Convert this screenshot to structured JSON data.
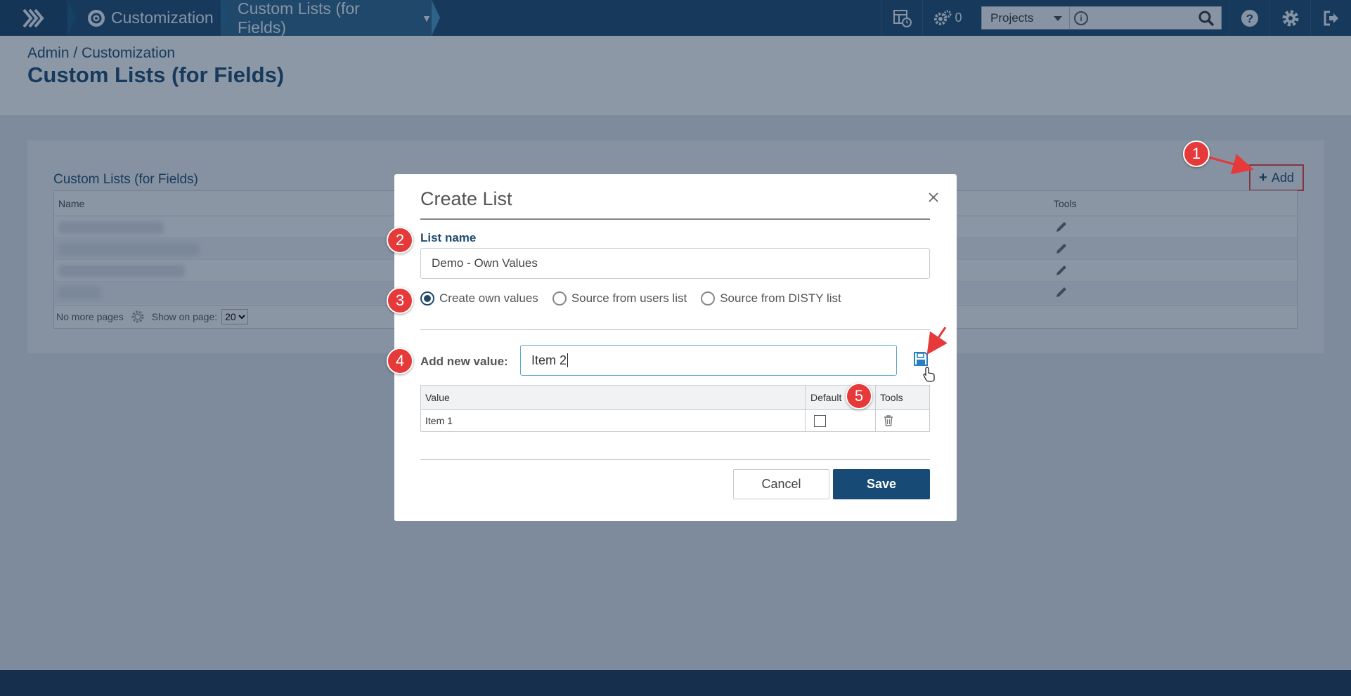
{
  "topbar": {
    "section": "Customization",
    "page": "Custom Lists (for Fields)",
    "counter": "0",
    "projects_label": "Projects",
    "search_placeholder": ""
  },
  "header": {
    "breadcrumb": "Admin / Customization",
    "title": "Custom Lists (for Fields)"
  },
  "panel": {
    "title": "Custom Lists (for Fields)",
    "add_label": "Add",
    "columns": {
      "name": "Name",
      "tools": "Tools"
    },
    "footer": {
      "pages": "No more pages",
      "show_on_page": "Show on page:",
      "page_size": "20"
    }
  },
  "modal": {
    "title": "Create List",
    "list_name_label": "List name",
    "list_name_value": "Demo - Own Values",
    "radios": [
      {
        "label": "Create own values",
        "selected": true
      },
      {
        "label": "Source from users list",
        "selected": false
      },
      {
        "label": "Source from DISTY list",
        "selected": false
      }
    ],
    "add_value_label": "Add new value:",
    "add_value_input": "Item 2",
    "table": {
      "headers": {
        "value": "Value",
        "default": "Default",
        "tools": "Tools"
      },
      "rows": [
        {
          "value": "Item 1",
          "default": false
        }
      ]
    },
    "cancel_label": "Cancel",
    "save_label": "Save"
  },
  "steps": [
    "1",
    "2",
    "3",
    "4",
    "5"
  ],
  "colors": {
    "brand": "#1d4a6e",
    "accent_red": "#e5393a",
    "save_button": "#174a74"
  }
}
